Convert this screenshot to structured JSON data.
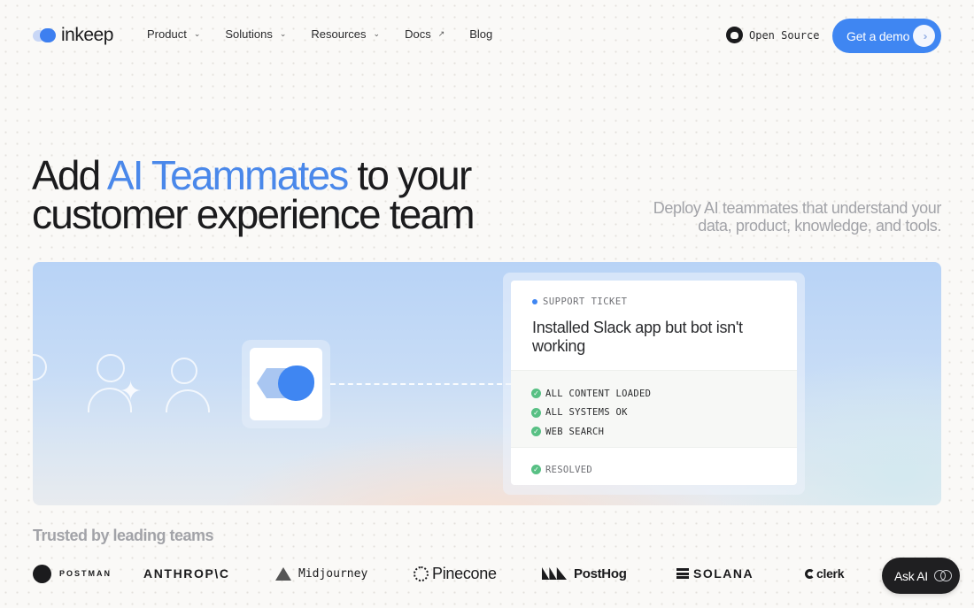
{
  "brand": {
    "logo_text": "inkeep"
  },
  "nav": {
    "items": [
      {
        "label": "Product"
      },
      {
        "label": "Solutions"
      },
      {
        "label": "Resources"
      },
      {
        "label": "Docs"
      },
      {
        "label": "Blog"
      }
    ],
    "open_source_label": "Open Source",
    "demo_button_label": "Get a demo"
  },
  "hero": {
    "headline_prefix": "Add ",
    "headline_accent": "AI Teammates",
    "headline_suffix": " to your customer experience team",
    "subhead": "Deploy AI teammates that understand your data, product, knowledge, and tools."
  },
  "ticket_card": {
    "tag": "SUPPORT TICKET",
    "title": "Installed Slack app but bot isn't working",
    "checks": [
      {
        "label": "ALL CONTENT LOADED"
      },
      {
        "label": "ALL SYSTEMS OK"
      },
      {
        "label": "WEB SEARCH"
      }
    ],
    "status": "RESOLVED"
  },
  "trusted": {
    "heading": "Trusted by leading teams",
    "logos": [
      {
        "name": "POSTMAN"
      },
      {
        "name": "ANTHROP\\C"
      },
      {
        "name": "Midjourney"
      },
      {
        "name": "Pinecone"
      },
      {
        "name": "PostHog"
      },
      {
        "name": "SOLANA"
      },
      {
        "name": "clerk"
      }
    ]
  },
  "ask_ai": {
    "label": "Ask AI"
  },
  "colors": {
    "accent": "#3f86f2",
    "headline_accent": "#4a88ea",
    "check_green": "#58c084",
    "background": "#faf9f7"
  },
  "icons": {
    "github": "github-icon",
    "chevron": "chevron-down-icon",
    "external": "arrow-up-right-icon",
    "demo_arrow": "double-chevron-right-icon",
    "check": "check-circle-icon",
    "ask_ai": "infinity-icon"
  }
}
